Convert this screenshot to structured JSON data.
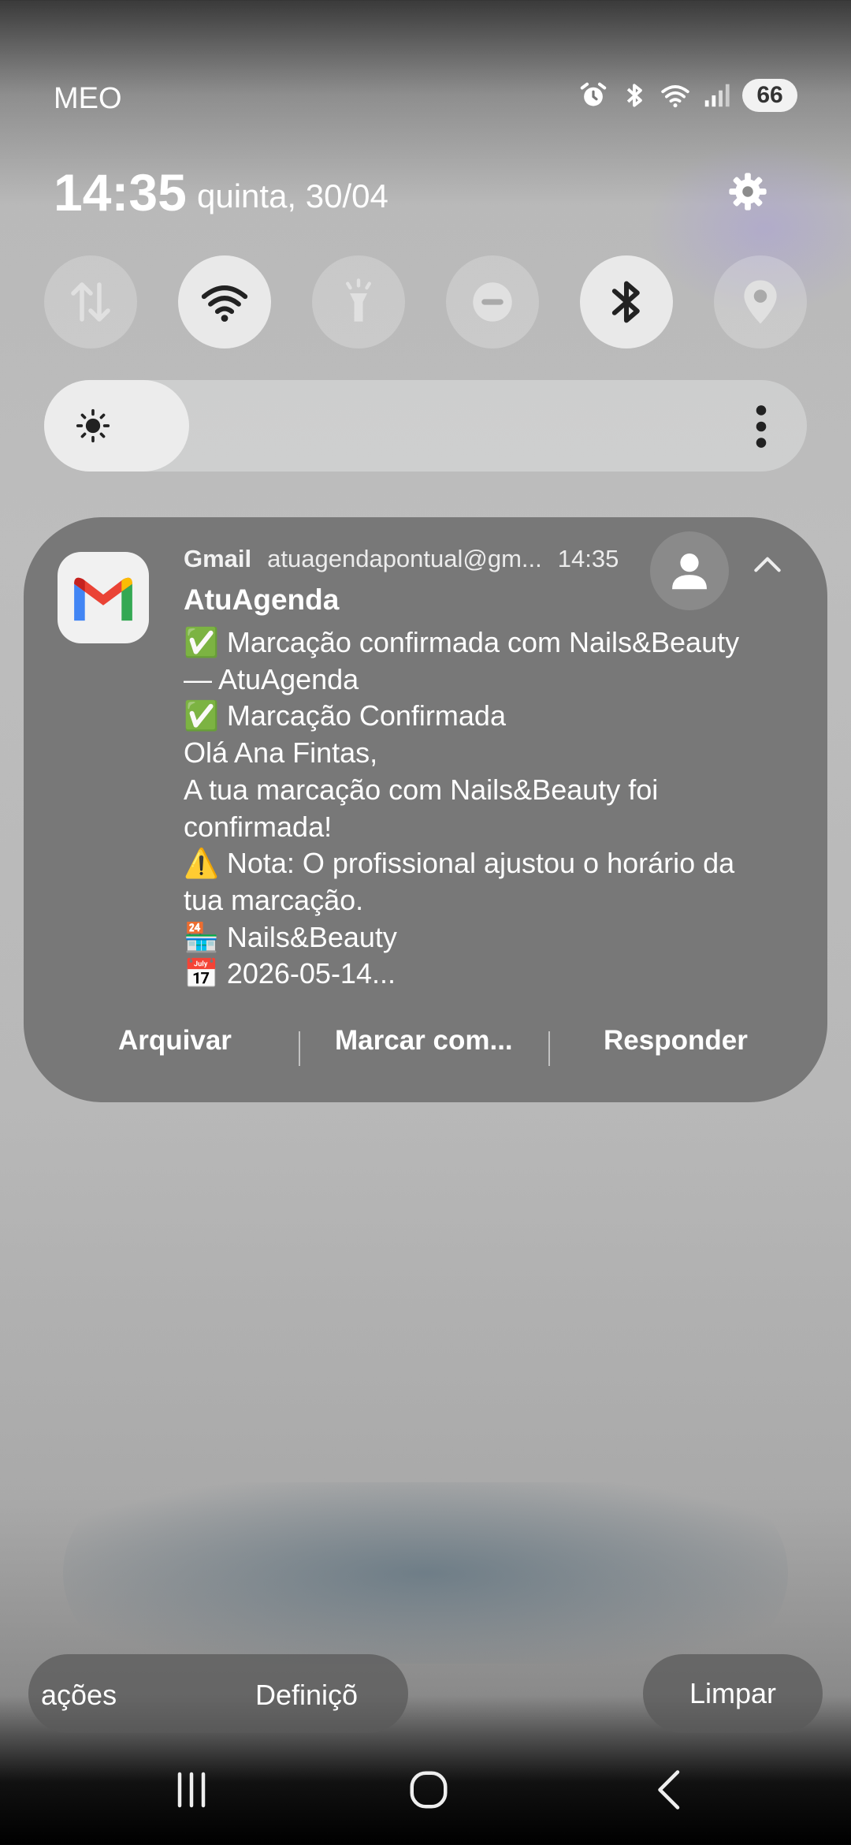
{
  "status_bar": {
    "carrier": "MEO",
    "battery": "66",
    "icons": [
      "alarm-icon",
      "bluetooth-icon",
      "wifi-icon",
      "signal-icon"
    ]
  },
  "header": {
    "time": "14:35",
    "date": "quinta, 30/04"
  },
  "quick_settings": [
    {
      "name": "mobile-data",
      "icon": "data-arrows-icon",
      "on": false
    },
    {
      "name": "wifi",
      "icon": "wifi-icon",
      "on": true
    },
    {
      "name": "flashlight",
      "icon": "flashlight-icon",
      "on": false
    },
    {
      "name": "do-not-disturb",
      "icon": "dnd-icon",
      "on": false
    },
    {
      "name": "bluetooth",
      "icon": "bluetooth-icon",
      "on": true
    },
    {
      "name": "location",
      "icon": "location-icon",
      "on": false
    }
  ],
  "brightness": {
    "level": 0.19
  },
  "notification": {
    "app_name": "Gmail",
    "account": "atuagendapontual@gm...",
    "time": "14:35",
    "sender": "AtuAgenda",
    "body_lines": [
      "✅ Marcação confirmada com Nails&Beauty",
      "— AtuAgenda",
      "✅ Marcação Confirmada",
      "Olá Ana Fintas,",
      "A tua marcação com Nails&Beauty foi",
      "confirmada!",
      "⚠️ Nota: O profissional ajustou o horário da",
      "tua marcação.",
      "🏪 Nails&Beauty",
      "📅 2026-05-14..."
    ],
    "actions": {
      "archive": "Arquivar",
      "mark": "Marcar com...",
      "reply": "Responder"
    }
  },
  "bottom": {
    "notification_settings": "ações",
    "settings": "Definiçõ",
    "clear": "Limpar"
  },
  "colors": {
    "accent_on": "#e9e9e9",
    "card": "#6e6e6e"
  }
}
